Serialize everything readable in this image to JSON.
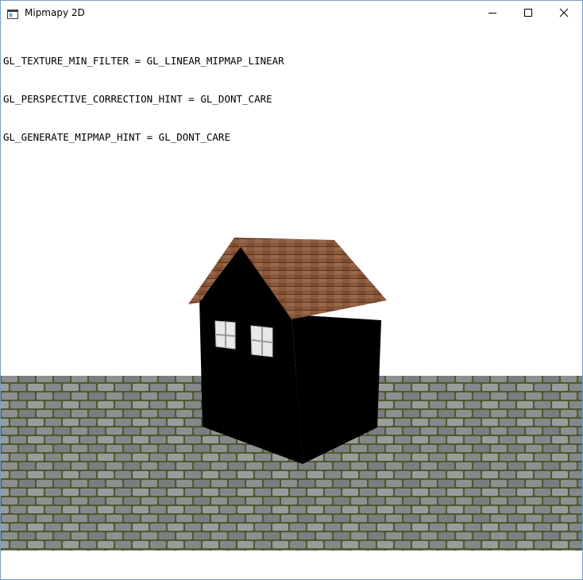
{
  "window": {
    "title": "Mipmapy 2D",
    "icons": {
      "app": "app-window-icon",
      "minimize": "minimize-icon",
      "maximize": "maximize-icon",
      "close": "close-icon"
    }
  },
  "overlay_text": [
    "GL_TEXTURE_MIN_FILTER = GL_LINEAR_MIPMAP_LINEAR",
    "GL_PERSPECTIVE_CORRECTION_HINT = GL_DONT_CARE",
    "GL_GENERATE_MIPMAP_HINT = GL_DONT_CARE"
  ],
  "scene": {
    "colors": {
      "background": "#ffffff",
      "house_walls": "#000000",
      "roof": "#8b5a3c",
      "roof_dark": "#6a3f28",
      "window_frame": "#e8e8e8",
      "window_glass": "#ffffff",
      "cobblestone": "#8a8c8c",
      "cobblestone_grout": "#4d5a32"
    }
  }
}
